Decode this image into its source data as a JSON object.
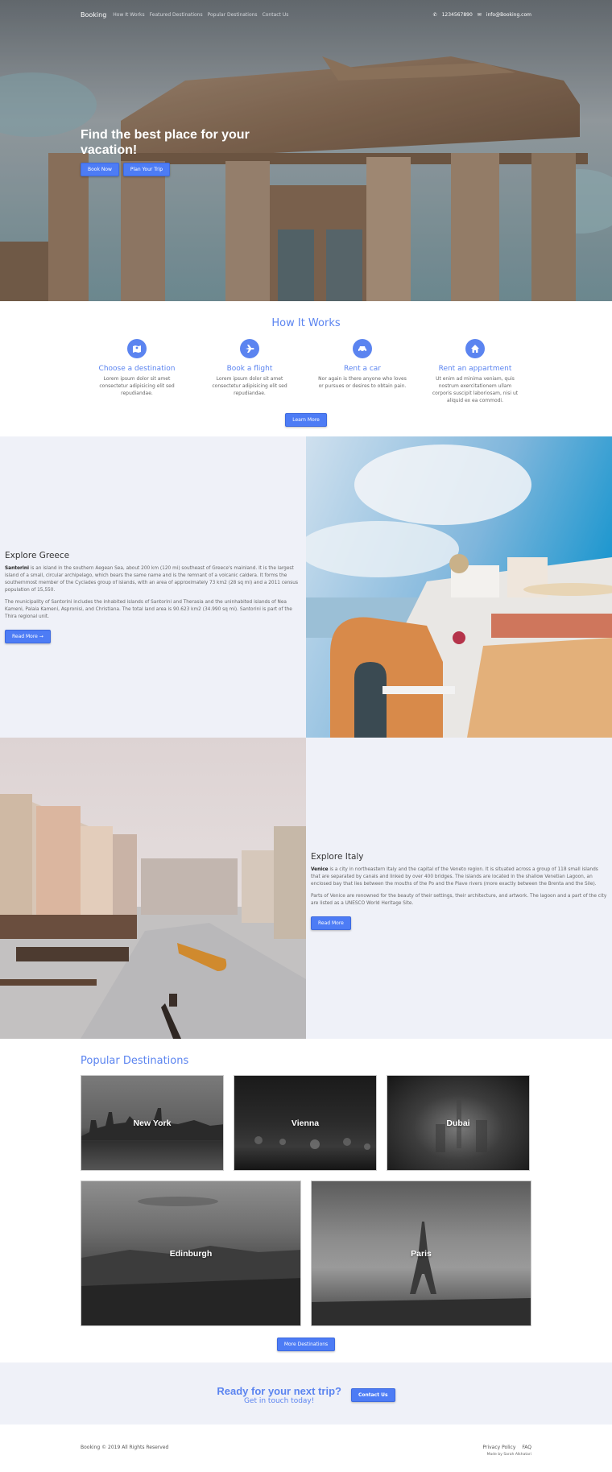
{
  "nav": {
    "brand": "Booking",
    "links": [
      "How It Works",
      "Featured Destinations",
      "Popular Destinations",
      "Contact Us"
    ],
    "phone": "1234567890",
    "email": "info@Booking.com"
  },
  "hero": {
    "title": "Find the best place for your vacation!",
    "book_now": "Book Now",
    "plan_trip": "Plan Your Trip"
  },
  "how": {
    "title": "How It Works",
    "steps": [
      {
        "icon": "map-icon",
        "title": "Choose a destination",
        "text": "Lorem ipsum dolor sit amet consectetur adipisicing elit sed repudiandae."
      },
      {
        "icon": "plane-icon",
        "title": "Book a flight",
        "text": "Lorem ipsum dolor sit amet consectetur adipisicing elit sed repudiandae."
      },
      {
        "icon": "car-icon",
        "title": "Rent a car",
        "text": "Nor again is there anyone who loves or pursues or desires to obtain pain."
      },
      {
        "icon": "home-icon",
        "title": "Rent an appartment",
        "text": "Ut enim ad minima veniam, quis nostrum exercitationem ullam corporis suscipit laboriosam, nisi ut aliquid ex ea commodi."
      }
    ],
    "learn_more": "Learn More"
  },
  "greece": {
    "title": "Explore Greece",
    "bold": "Santorini",
    "p1": " is an island in the southern Aegean Sea, about 200 km (120 mi) southeast of Greece's mainland. It is the largest island of a small, circular archipelago, which bears the same name and is the remnant of a volcanic caldera. It forms the southernmost member of the Cyclades group of islands, with an area of approximately 73 km2 (28 sq mi) and a 2011 census population of 15,550.",
    "p2": "The municipality of Santorini includes the inhabited islands of Santorini and Therasia and the uninhabited islands of Nea Kameni, Palaia Kameni, Aspronisi, and Christiana. The total land area is 90.623 km2 (34.990 sq mi). Santorini is part of the Thira regional unit.",
    "button": "Read More →"
  },
  "italy": {
    "title": "Explore Italy",
    "bold": "Venice",
    "p1": " is a city in northeastern Italy and the capital of the Veneto region. It is situated across a group of 118 small islands that are separated by canals and linked by over 400 bridges. The islands are located in the shallow Venetian Lagoon, an enclosed bay that lies between the mouths of the Po and the Piave rivers (more exactly between the Brenta and the Sile).",
    "p2": "Parts of Venice are renowned for the beauty of their settings, their architecture, and artwork. The lagoon and a part of the city are listed as a UNESCO World Heritage Site.",
    "button": "Read More"
  },
  "popular": {
    "title": "Popular Destinations",
    "cities": [
      "New York",
      "Vienna",
      "Dubai",
      "Edinburgh",
      "Paris"
    ],
    "button": "More Destinations"
  },
  "cta": {
    "title": "Ready for your next trip?",
    "subtitle": "Get in touch today!",
    "button": "Contact Us"
  },
  "footer": {
    "copyright": "Booking © 2019 All Rights Reserved",
    "privacy": "Privacy Policy",
    "faq": "FAQ",
    "made_by": "Made by Sarah Alkhatari"
  }
}
